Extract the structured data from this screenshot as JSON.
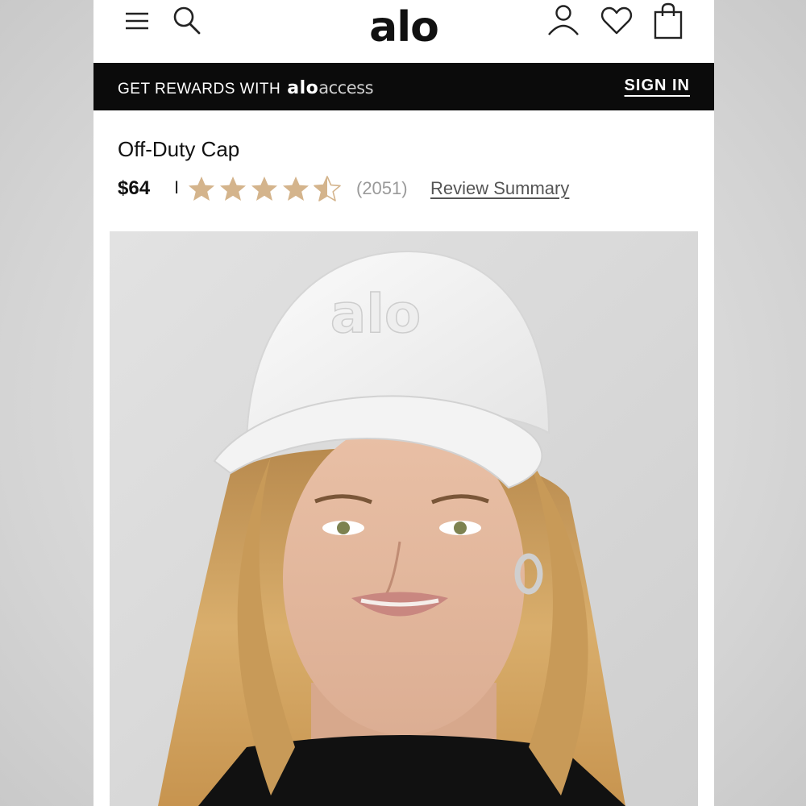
{
  "header": {
    "logo_text": "alo",
    "icons": [
      "menu-icon",
      "search-icon",
      "account-icon",
      "wishlist-icon",
      "shopping-bag-icon"
    ]
  },
  "rewards_bar": {
    "prefix": "GET REWARDS WITH",
    "brand_bold": "alo",
    "brand_light": "access",
    "sign_in": "SIGN IN"
  },
  "product": {
    "title": "Off-Duty Cap",
    "price": "$64",
    "separator": "I",
    "rating_stars": 4.5,
    "review_count": "(2051)",
    "review_summary": "Review Summary",
    "cap_logo": "alo"
  },
  "colors": {
    "star": "#d4b48c",
    "bar_bg": "#0b0b0b",
    "text": "#111111"
  }
}
